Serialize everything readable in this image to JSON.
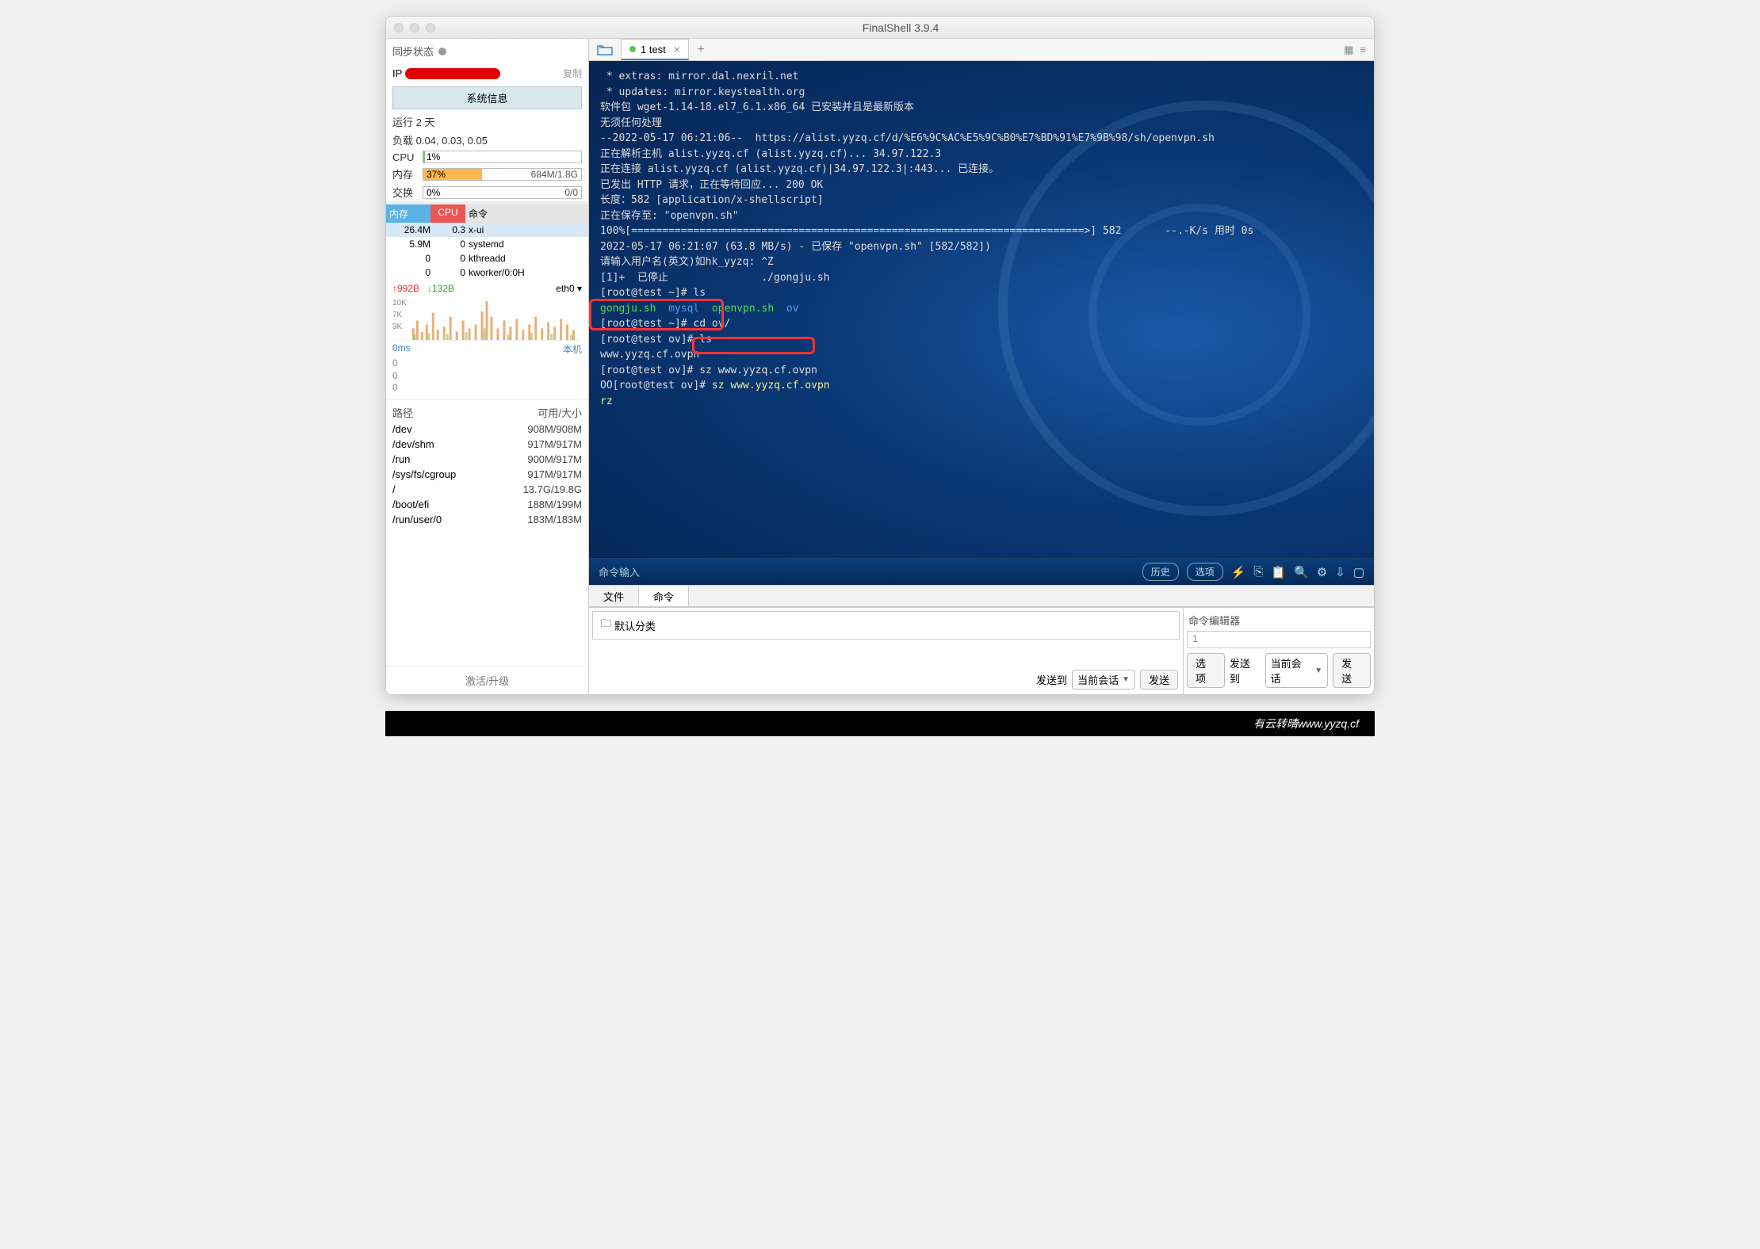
{
  "window": {
    "title": "FinalShell 3.9.4"
  },
  "sidebar": {
    "sync_status": "同步状态",
    "ip_label": "IP",
    "copy": "复制",
    "sysinfo_btn": "系统信息",
    "uptime": "运行 2 天",
    "load": "负载 0.04, 0.03, 0.05",
    "cpu": {
      "label": "CPU",
      "pct": "1%",
      "width": "1%"
    },
    "mem": {
      "label": "内存",
      "pct": "37%",
      "width": "37%",
      "right": "684M/1.8G"
    },
    "swap": {
      "label": "交换",
      "pct": "0%",
      "width": "0%",
      "right": "0/0"
    },
    "ph": {
      "mem": "内存",
      "cpu": "CPU",
      "cmd": "命令"
    },
    "procs": [
      {
        "mem": "26.4M",
        "cpu": "0.3",
        "cmd": "x-ui"
      },
      {
        "mem": "5.9M",
        "cpu": "0",
        "cmd": "systemd"
      },
      {
        "mem": "0",
        "cpu": "0",
        "cmd": "kthreadd"
      },
      {
        "mem": "0",
        "cpu": "0",
        "cmd": "kworker/0:0H"
      }
    ],
    "net": {
      "up": "↑992B",
      "dn": "↓132B",
      "iface": "eth0 ▾"
    },
    "chart_y": {
      "a": "10K",
      "b": "7K",
      "c": "3K"
    },
    "ping": {
      "ms": "0ms",
      "label": "本机"
    },
    "zeros": "0\n0\n0",
    "fs": {
      "h1": "路径",
      "h2": "可用/大小",
      "rows": [
        {
          "p": "/dev",
          "s": "908M/908M"
        },
        {
          "p": "/dev/shm",
          "s": "917M/917M"
        },
        {
          "p": "/run",
          "s": "900M/917M"
        },
        {
          "p": "/sys/fs/cgroup",
          "s": "917M/917M"
        },
        {
          "p": "/",
          "s": "13.7G/19.8G",
          "green": true
        },
        {
          "p": "/boot/efi",
          "s": "188M/199M"
        },
        {
          "p": "/run/user/0",
          "s": "183M/183M"
        }
      ]
    },
    "footer": "激活/升级"
  },
  "tab": {
    "label": "1 test"
  },
  "terminal": {
    "lines": [
      {
        "t": " * extras: mirror.dal.nexril.net"
      },
      {
        "t": " * updates: mirror.keystealth.org"
      },
      {
        "t": "软件包 wget-1.14-18.el7_6.1.x86_64 已安装并且是最新版本"
      },
      {
        "t": "无须任何处理"
      },
      {
        "t": "--2022-05-17 06:21:06--  https://alist.yyzq.cf/d/%E6%9C%AC%E5%9C%B0%E7%BD%91%E7%9B%98/sh/openvpn.sh"
      },
      {
        "t": "正在解析主机 alist.yyzq.cf (alist.yyzq.cf)... 34.97.122.3"
      },
      {
        "t": "正在连接 alist.yyzq.cf (alist.yyzq.cf)|34.97.122.3|:443... 已连接。"
      },
      {
        "t": "已发出 HTTP 请求，正在等待回应... 200 OK"
      },
      {
        "t": "长度：582 [application/x-shellscript]"
      },
      {
        "t": "正在保存至: \"openvpn.sh\""
      },
      {
        "t": ""
      },
      {
        "t": "100%[=========================================================================>] 582       --.-K/s 用时 0s"
      },
      {
        "t": ""
      },
      {
        "t": "2022-05-17 06:21:07 (63.8 MB/s) - 已保存 \"openvpn.sh\" [582/582])"
      },
      {
        "t": ""
      },
      {
        "t": "请输入用户名(英文)如hk_yyzq: ^Z"
      },
      {
        "t": "[1]+  已停止               ./gongju.sh"
      },
      {
        "t": "[root@test ~]# ls"
      },
      {
        "html": "<span class='grn-t'>gongju.sh</span>  <span class='blu-t'>mysql</span>  <span class='grn-t'>openvpn.sh</span>  <span class='blu-t'>ov</span>"
      },
      {
        "t": "[root@test ~]# cd ov/"
      },
      {
        "t": "[root@test ov]# ls"
      },
      {
        "t": "www.yyzq.cf.ovpn"
      },
      {
        "t": "[root@test ov]# sz www.yyzq.cf.ovpn"
      },
      {
        "html": "OO[root@test ov]# <span class='yel'>sz www.yyzq.cf.ovpn</span>"
      },
      {
        "html": "<span class='yel'>rz</span>"
      }
    ]
  },
  "cmdbar": {
    "placeholder": "命令输入",
    "history": "历史",
    "options": "选项"
  },
  "bottabs": {
    "file": "文件",
    "cmd": "命令"
  },
  "botpanel": {
    "category": "默认分类",
    "send_to": "发送到",
    "current": "当前会话",
    "send": "发送",
    "editor": "命令编辑器",
    "line": "1",
    "opt": "选项"
  },
  "watermark": "有云转晴www.yyzq.cf"
}
